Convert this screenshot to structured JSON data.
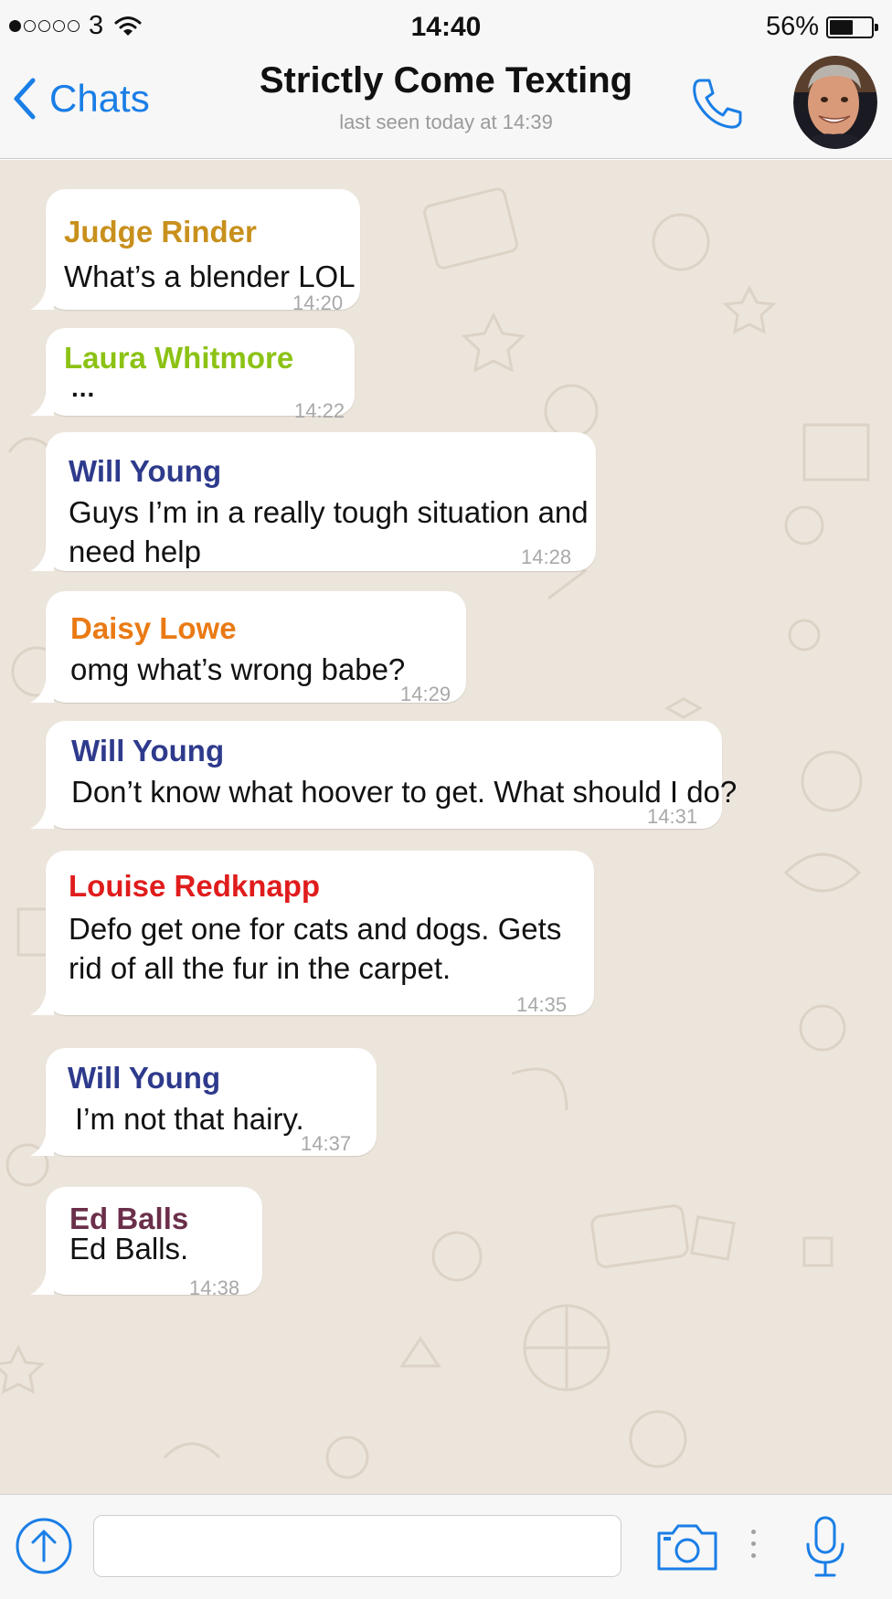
{
  "status_bar": {
    "carrier": "3",
    "signal_bars_filled": 1,
    "signal_bars_total": 5,
    "time": "14:40",
    "battery_percent_label": "56%",
    "battery_level": 0.56,
    "wifi_icon": "wifi-icon"
  },
  "header": {
    "back_label": "Chats",
    "title": "Strictly Come Texting",
    "subtitle": "last seen today at 14:39",
    "call_icon": "phone-icon",
    "avatar_icon": "contact-avatar"
  },
  "theme": {
    "accent": "#1a7ee6",
    "chat_background": "#ece5dc",
    "bubble": "#ffffff",
    "timestamp": "#a8a8a8"
  },
  "messages": [
    {
      "sender": "Judge Rinder",
      "sender_color": "#c8901c",
      "text": "What’s a blender LOL",
      "time": "14:20"
    },
    {
      "sender": "Laura Whitmore",
      "sender_color": "#8cc215",
      "text": "...",
      "time": "14:22"
    },
    {
      "sender": "Will Young",
      "sender_color": "#2e3a8c",
      "text": "Guys I’m in a really tough situation and\nneed help",
      "time": "14:28"
    },
    {
      "sender": "Daisy Lowe",
      "sender_color": "#ea7a14",
      "text": "omg what’s wrong babe?",
      "time": "14:29"
    },
    {
      "sender": "Will Young",
      "sender_color": "#2e3a8c",
      "text": "Don’t know what hoover to get. What should I do?",
      "time": "14:31"
    },
    {
      "sender": "Louise Redknapp",
      "sender_color": "#e01c1c",
      "text": "Defo get one for cats and dogs. Gets\nrid of all the fur in the carpet.",
      "time": "14:35"
    },
    {
      "sender": "Will Young",
      "sender_color": "#2e3a8c",
      "text": "I’m not that hairy.",
      "time": "14:37"
    },
    {
      "sender": "Ed Balls",
      "sender_color": "#6b2f4a",
      "text": "Ed Balls.",
      "time": "14:38"
    }
  ],
  "input_bar": {
    "attach_icon": "upload-arrow-icon",
    "message_value": "",
    "camera_icon": "camera-icon",
    "mic_icon": "microphone-icon"
  }
}
